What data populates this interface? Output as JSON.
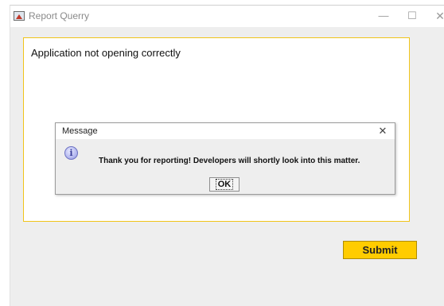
{
  "window": {
    "title": "Report Querry",
    "controls": {
      "minimize": "—",
      "maximize": "☐",
      "close": "✕"
    }
  },
  "main": {
    "report_text": "Application not opening correctly",
    "submit_label": "Submit"
  },
  "dialog": {
    "title": "Message",
    "close": "✕",
    "icon_glyph": "i",
    "message": "Thank you for reporting! Developers will shortly look into this matter.",
    "ok_label": "OK"
  },
  "colors": {
    "accent": "#ffcc00",
    "text_area_border": "#f0c419"
  }
}
